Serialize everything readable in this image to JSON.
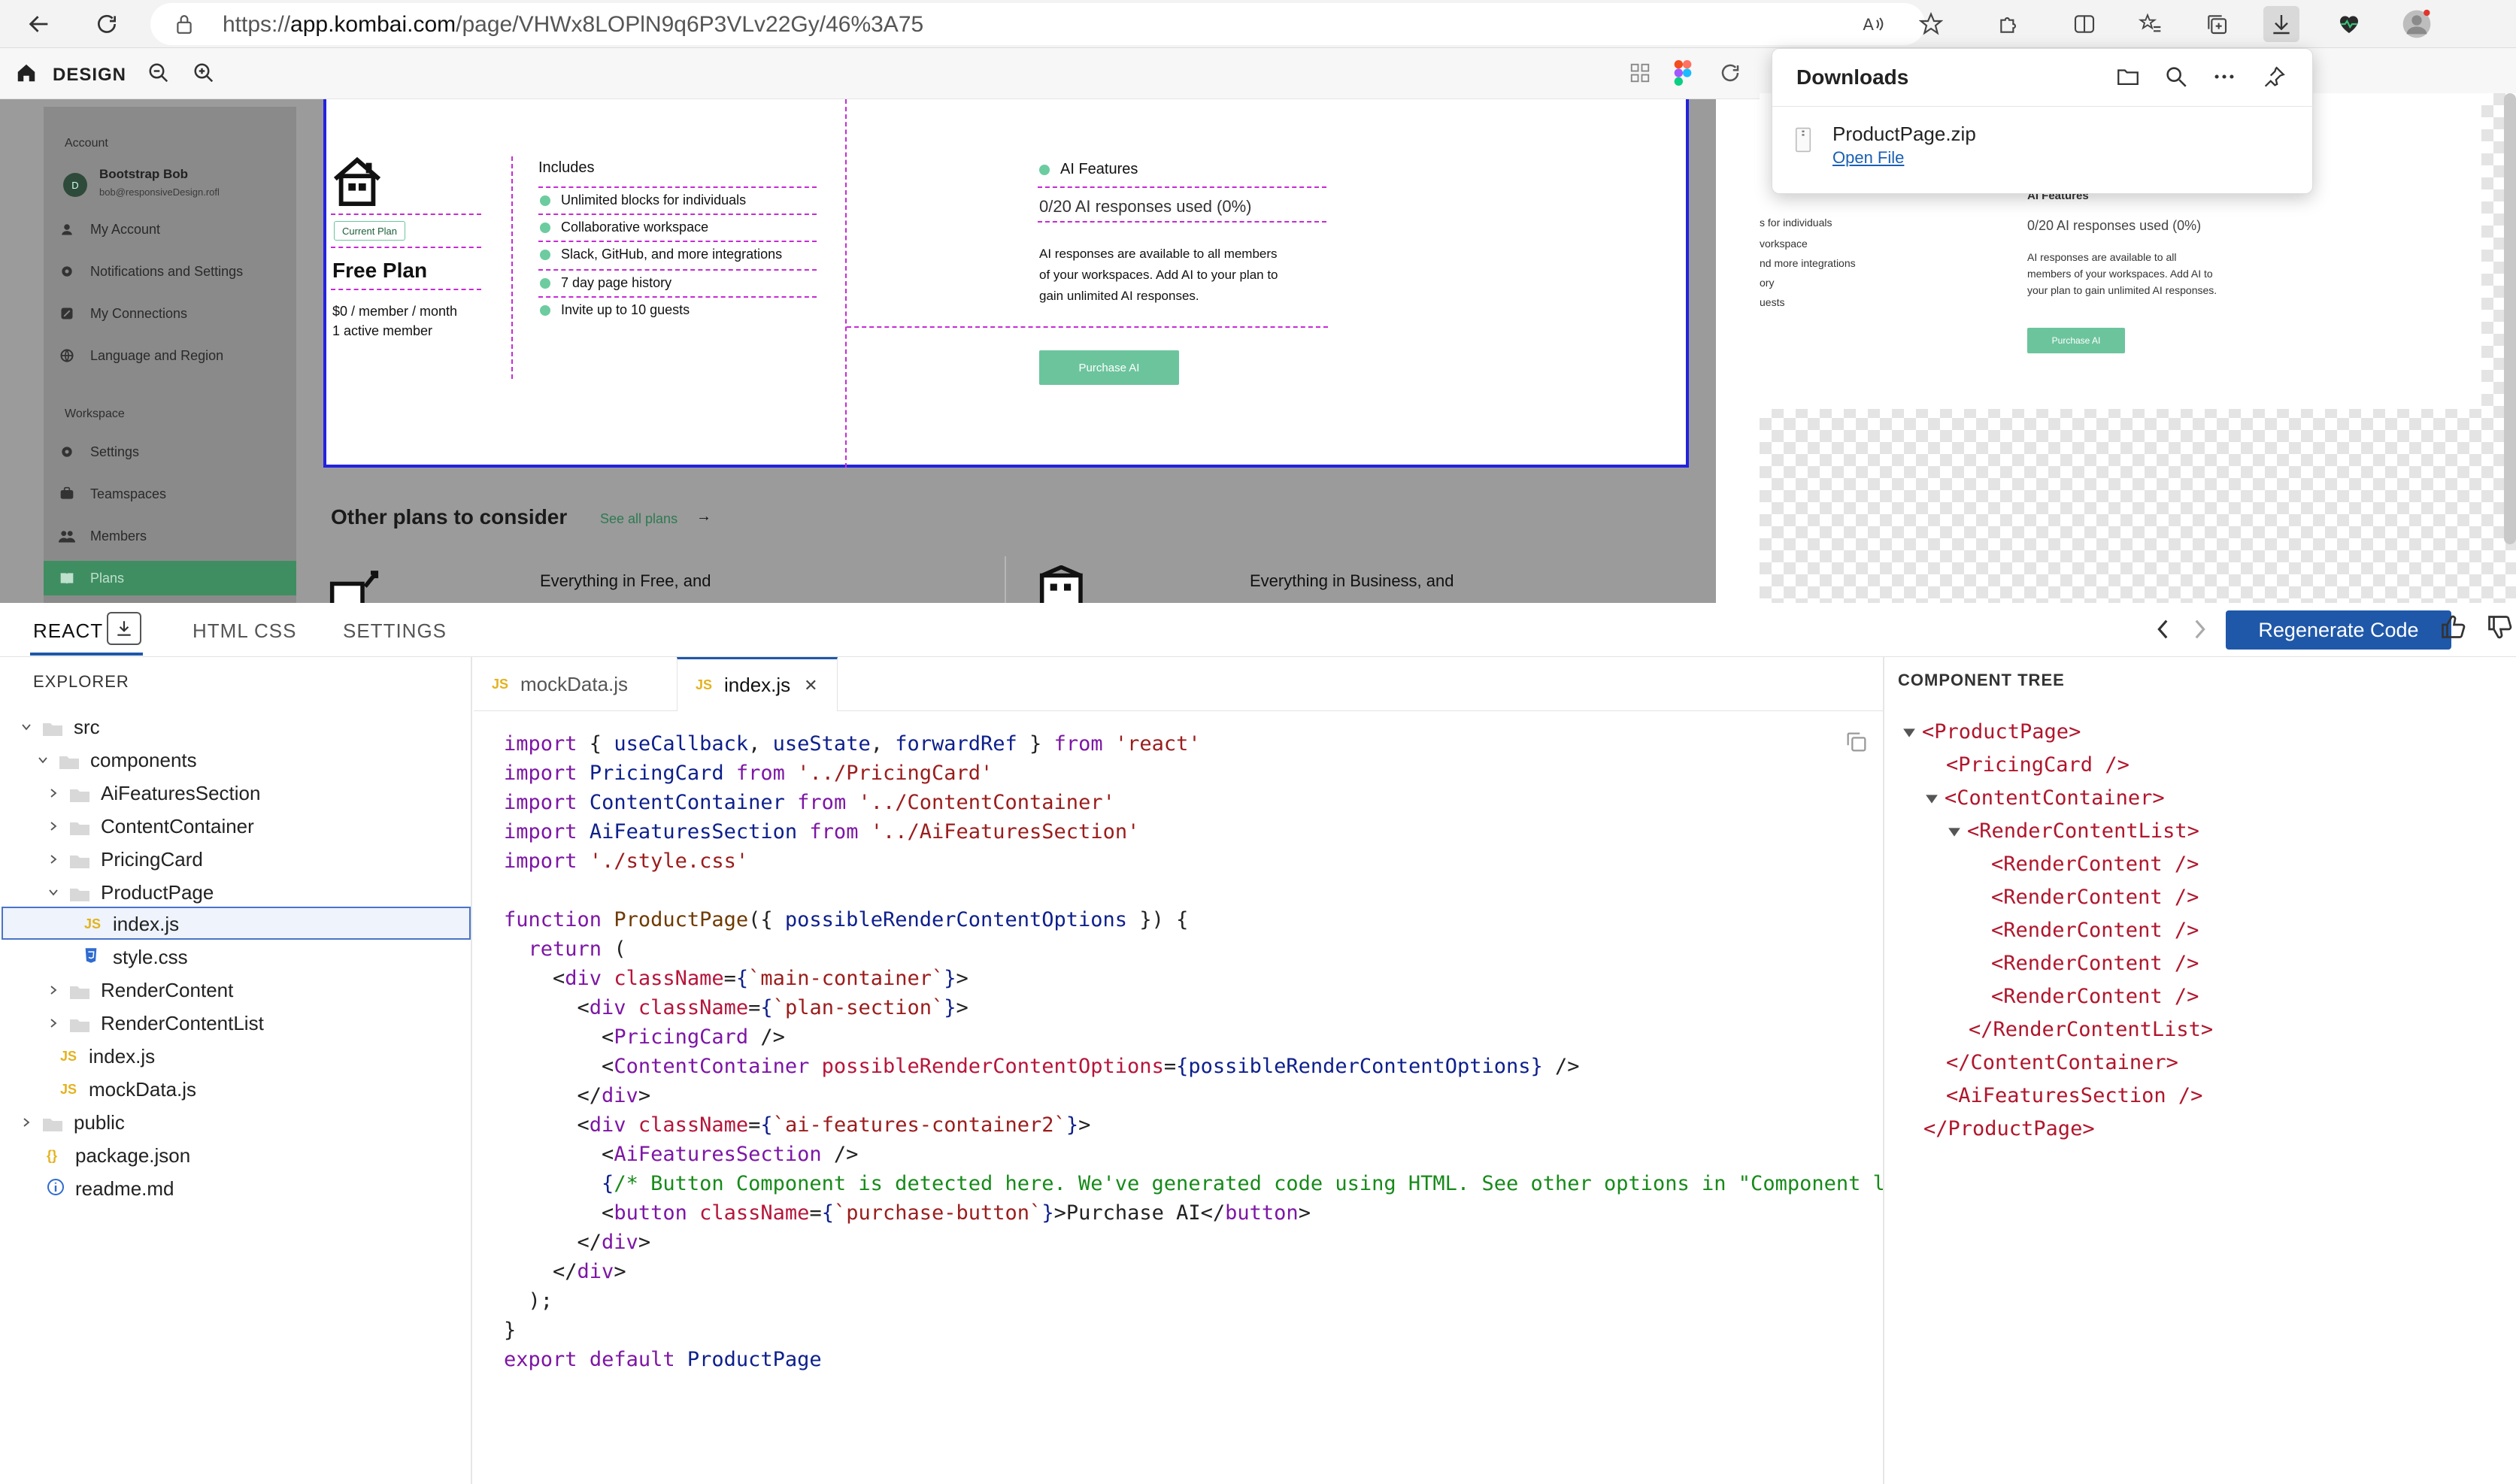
{
  "browser": {
    "url_prefix": "https://",
    "url_domain": "app.kombai.com",
    "url_path": "/page/VHWx8LOPlN9q6P3VLv22Gy/46%3A75"
  },
  "app_toolbar": {
    "design_label": "DESIGN"
  },
  "canvas": {
    "sidebar": {
      "account_heading": "Account",
      "user_name": "Bootstrap Bob",
      "user_email": "bob@responsiveDesign.rofl",
      "avatar_letter": "D",
      "items": [
        "My Account",
        "Notifications and Settings",
        "My Connections",
        "Language and Region"
      ],
      "workspace_heading": "Workspace",
      "workspace_items": [
        "Settings",
        "Teamspaces",
        "Members",
        "Plans"
      ]
    },
    "plan": {
      "badge": "Current Plan",
      "name": "Free Plan",
      "price": "$0 / member / month",
      "members": "1 active member",
      "includes_title": "Includes",
      "includes": [
        "Unlimited blocks for individuals",
        "Collaborative workspace",
        "Slack, GitHub, and more integrations",
        "7 day page history",
        "Invite up to 10 guests"
      ],
      "ai_title": "AI Features",
      "ai_usage": "0/20 AI responses used (0%)",
      "ai_desc_1": "AI responses are available to all members",
      "ai_desc_2": "of your workspaces. Add AI to your plan to",
      "ai_desc_3": "gain unlimited AI responses.",
      "purchase_label": "Purchase AI"
    },
    "other_plans": {
      "title": "Other plans to consider",
      "see_all": "See all plans",
      "arrow": "→",
      "plan1": "Everything in Free, and",
      "plan2": "Everything in Business, and"
    }
  },
  "preview": {
    "ai_title": "AI Features",
    "ai_usage": "0/20 AI responses used (0%)",
    "desc_1": "AI responses are available to all",
    "desc_2": "members of your workspaces. Add AI to",
    "desc_3": "your plan to gain unlimited AI responses.",
    "purchase_label": "Purchase AI",
    "frag_1": "s for individuals",
    "frag_2": "vorkspace",
    "frag_3": "nd more integrations",
    "frag_4": "ory",
    "frag_5": "uests"
  },
  "downloads": {
    "title": "Downloads",
    "file_name": "ProductPage.zip",
    "open_link": "Open File"
  },
  "panel": {
    "tabs": [
      "REACT",
      "HTML CSS",
      "SETTINGS"
    ],
    "regenerate_label": "Regenerate Code"
  },
  "explorer": {
    "title": "EXPLORER",
    "tree": [
      {
        "label": "src",
        "type": "folder"
      },
      {
        "label": "components",
        "type": "folder"
      },
      {
        "label": "AiFeaturesSection",
        "type": "folder"
      },
      {
        "label": "ContentContainer",
        "type": "folder"
      },
      {
        "label": "PricingCard",
        "type": "folder"
      },
      {
        "label": "ProductPage",
        "type": "folder"
      },
      {
        "label": "index.js",
        "type": "js"
      },
      {
        "label": "style.css",
        "type": "css"
      },
      {
        "label": "RenderContent",
        "type": "folder"
      },
      {
        "label": "RenderContentList",
        "type": "folder"
      },
      {
        "label": "index.js",
        "type": "js"
      },
      {
        "label": "mockData.js",
        "type": "js"
      },
      {
        "label": "public",
        "type": "folder"
      },
      {
        "label": "package.json",
        "type": "json"
      },
      {
        "label": "readme.md",
        "type": "md"
      }
    ]
  },
  "editor": {
    "tabs": [
      {
        "label": "mockData.js",
        "badge": "JS"
      },
      {
        "label": "index.js",
        "badge": "JS",
        "close": "✕"
      }
    ],
    "lines": [
      "import { useCallback, useState, forwardRef } from 'react'",
      "import PricingCard from '../PricingCard'",
      "import ContentContainer from '../ContentContainer'",
      "import AiFeaturesSection from '../AiFeaturesSection'",
      "import './style.css'",
      "",
      "function ProductPage({ possibleRenderContentOptions }) {",
      "  return (",
      "    <div className={`main-container`}>",
      "      <div className={`plan-section`}>",
      "        <PricingCard />",
      "        <ContentContainer possibleRenderContentOptions={possibleRenderContentOptions} />",
      "      </div>",
      "      <div className={`ai-features-container2`}>",
      "        <AiFeaturesSection />",
      "        {/* Button Component is detected here. We've generated code using HTML. See other options in \"Component librar",
      "        <button className={`purchase-button`}>Purchase AI</button>",
      "      </div>",
      "    </div>",
      "  );",
      "}",
      "export default ProductPage"
    ]
  },
  "component_tree": {
    "title": "COMPONENT TREE",
    "nodes": [
      {
        "label": "<ProductPage>",
        "depth": 0,
        "chev": true
      },
      {
        "label": "<PricingCard />",
        "depth": 1,
        "chev": false
      },
      {
        "label": "<ContentContainer>",
        "depth": 1,
        "chev": true
      },
      {
        "label": "<RenderContentList>",
        "depth": 2,
        "chev": true
      },
      {
        "label": "<RenderContent />",
        "depth": 3,
        "chev": false
      },
      {
        "label": "<RenderContent />",
        "depth": 3,
        "chev": false
      },
      {
        "label": "<RenderContent />",
        "depth": 3,
        "chev": false
      },
      {
        "label": "<RenderContent />",
        "depth": 3,
        "chev": false
      },
      {
        "label": "<RenderContent />",
        "depth": 3,
        "chev": false
      },
      {
        "label": "</RenderContentList>",
        "depth": 2,
        "chev": false
      },
      {
        "label": "</ContentContainer>",
        "depth": 1,
        "chev": false
      },
      {
        "label": "<AiFeaturesSection />",
        "depth": 1,
        "chev": false
      },
      {
        "label": "</ProductPage>",
        "depth": 0,
        "chev": false
      }
    ]
  },
  "colors": {
    "accent": "#1f58a9",
    "green": "#6cc49d",
    "tag": "#b0162c"
  }
}
